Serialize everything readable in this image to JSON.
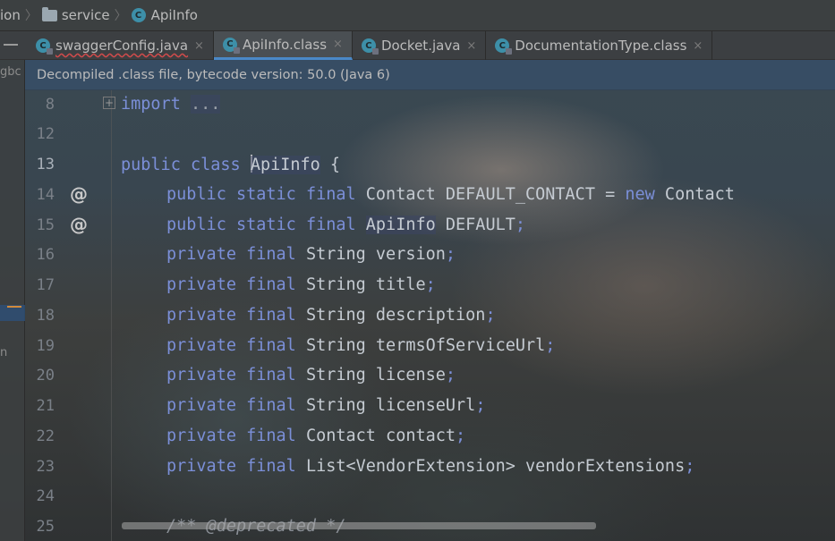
{
  "breadcrumb": {
    "frag": "ion",
    "folder": "service",
    "file": "ApiInfo",
    "class_icon_letter": "C"
  },
  "tabs": [
    {
      "label": "swaggerConfig.java",
      "close": "×"
    },
    {
      "label": "ApiInfo.class",
      "close": "×"
    },
    {
      "label": "Docket.java",
      "close": "×"
    },
    {
      "label": "DocumentationType.class",
      "close": "×"
    }
  ],
  "side_strip": {
    "frag1": "gbc",
    "frag2": "n"
  },
  "banner": {
    "text": "Decompiled .class file, bytecode version: 50.0 (Java 6)"
  },
  "editor": {
    "lines": [
      {
        "num": "8"
      },
      {
        "num": "12"
      },
      {
        "num": "13"
      },
      {
        "num": "14",
        "annotation": "@"
      },
      {
        "num": "15",
        "annotation": "@"
      },
      {
        "num": "16"
      },
      {
        "num": "17"
      },
      {
        "num": "18"
      },
      {
        "num": "19"
      },
      {
        "num": "20"
      },
      {
        "num": "21"
      },
      {
        "num": "22"
      },
      {
        "num": "23"
      },
      {
        "num": "24"
      },
      {
        "num": "25"
      }
    ],
    "fold_marker": "+",
    "tokens": {
      "import": "import",
      "ellipsis": "...",
      "public": "public",
      "class": "class",
      "static": "static",
      "final": "final",
      "private": "private",
      "new": "new",
      "ApiInfo": "ApiInfo",
      "open_brace": " {",
      "Contact": "Contact",
      "String": "String",
      "default_contact": " DEFAULT_CONTACT = ",
      "contact_ctor": " Contact",
      "default": " DEFAULT",
      "semi": ";",
      "version": " version",
      "title": " title",
      "description": " description",
      "termsOfServiceUrl": " termsOfServiceUrl",
      "license": " license",
      "licenseUrl": " licenseUrl",
      "contact": " contact",
      "list_type": "List<VendorExtension>",
      "vendorExtensions": " vendorExtensions",
      "deprecated_comment": "/** @deprecated */"
    }
  },
  "colors": {
    "keyword": "#7b8fd8",
    "text": "#c5cbd2",
    "banner_bg": "#374e65",
    "tab_underline": "#4a88c7"
  }
}
